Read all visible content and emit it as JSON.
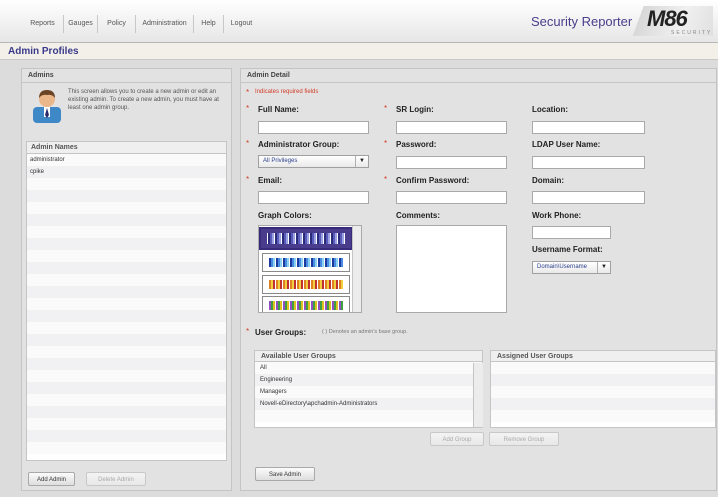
{
  "nav": {
    "tabs": [
      "Reports",
      "Gauges",
      "Policy",
      "Administration",
      "Help",
      "Logout"
    ],
    "product_name": "Security Reporter",
    "logo_text": "M86",
    "logo_sub": "SECURITY"
  },
  "page": {
    "title": "Admin Profiles"
  },
  "admins_panel": {
    "heading": "Admins",
    "intro": "This screen allows you to create a new admin or edit an existing admin. To create a new admin, you must have at least one admin group.",
    "list_header": "Admin Names",
    "names": [
      "administrator",
      "cpike"
    ],
    "add_button": "Add Admin",
    "delete_button": "Delete Admin"
  },
  "detail_panel": {
    "heading": "Admin Detail",
    "required_note": "Indicates required fields",
    "full_name_label": "Full Name:",
    "sr_login_label": "SR Login:",
    "location_label": "Location:",
    "admin_group_label": "Administrator Group:",
    "admin_group_value": "All Privileges",
    "password_label": "Password:",
    "ldap_label": "LDAP User Name:",
    "email_label": "Email:",
    "confirm_password_label": "Confirm Password:",
    "domain_label": "Domain:",
    "graph_colors_label": "Graph Colors:",
    "comments_label": "Comments:",
    "work_phone_label": "Work Phone:",
    "username_format_label": "Username Format:",
    "username_format_value": "Domain\\Username",
    "user_groups_label": "User Groups:",
    "user_groups_note": "( ) Denotes an admin's base group.",
    "available_header": "Available User Groups",
    "available_groups": [
      "All",
      "Engineering",
      "Managers",
      "Novell-eDirectory\\apchadmin-Administrators"
    ],
    "assigned_header": "Assigned User Groups",
    "add_group_button": "Add Group",
    "remove_group_button": "Remove Group",
    "save_button": "Save Admin"
  },
  "colors": {
    "accent": "#3a3a8a",
    "required": "#d23c28"
  }
}
